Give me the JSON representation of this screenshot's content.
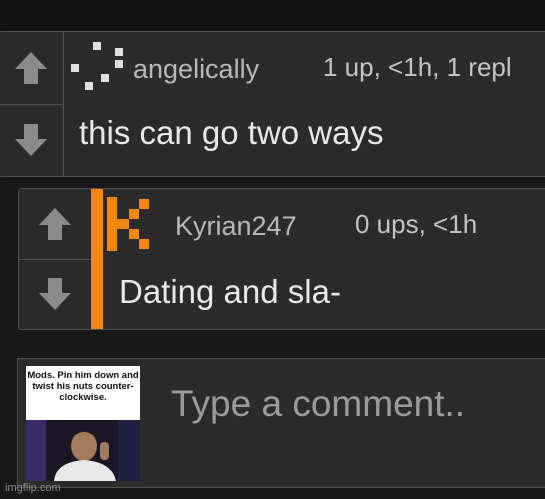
{
  "comments": [
    {
      "username": "angelically",
      "meta": "1 up, <1h, 1 repl",
      "text": "this can go two ways",
      "avatar_icon": "pixel-avatar-icon"
    },
    {
      "username": "Kyrian247",
      "meta": "0 ups, <1h",
      "text": "Dating and sla-",
      "avatar_icon": "orange-k-avatar-icon",
      "accent_color": "#f5870a"
    }
  ],
  "composer": {
    "placeholder": "Type a comment..",
    "meme_caption": "Mods. Pin him down and twist his nuts counter-clockwise."
  },
  "watermark": "imgflip.com",
  "colors": {
    "background": "#181818",
    "panel": "#2b2b2b",
    "border": "#505050",
    "accent": "#f5870a",
    "arrow": "#8a8a8a"
  }
}
